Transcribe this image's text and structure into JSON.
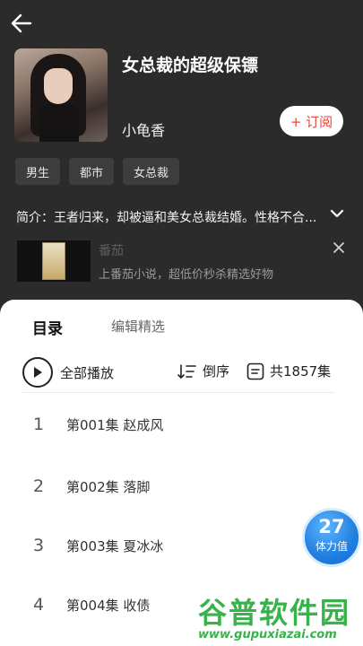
{
  "header": {
    "back_icon": "arrow-left-icon"
  },
  "book": {
    "title": "女总裁的超级保镖",
    "author": "小龟香",
    "subscribe_label": "+ 订阅",
    "tags": [
      "男生",
      "都市",
      "女总裁"
    ],
    "intro": "简介：王者归来，却被逼和美女总裁结婚。性格不合..."
  },
  "ad": {
    "title": "番茄",
    "description": "上番茄小说，超低价秒杀精选好物"
  },
  "sheet": {
    "tabs": [
      "目录",
      "编辑精选"
    ],
    "play_all_label": "全部播放",
    "sort_label": "倒序",
    "total_label": "共1857集"
  },
  "episodes": [
    {
      "num": "1",
      "title": "第001集  赵成风"
    },
    {
      "num": "2",
      "title": "第002集  落脚"
    },
    {
      "num": "3",
      "title": "第003集  夏冰冰"
    },
    {
      "num": "4",
      "title": "第004集  收债"
    }
  ],
  "stamina": {
    "value": "27",
    "label": "体力值"
  },
  "watermark": {
    "text": "谷普软件园",
    "url": "www.gupuxiazai.com"
  },
  "colors": {
    "accent": "#e8433a",
    "stamina_blue": "#1f7fe0",
    "watermark_green": "#38b24a"
  }
}
